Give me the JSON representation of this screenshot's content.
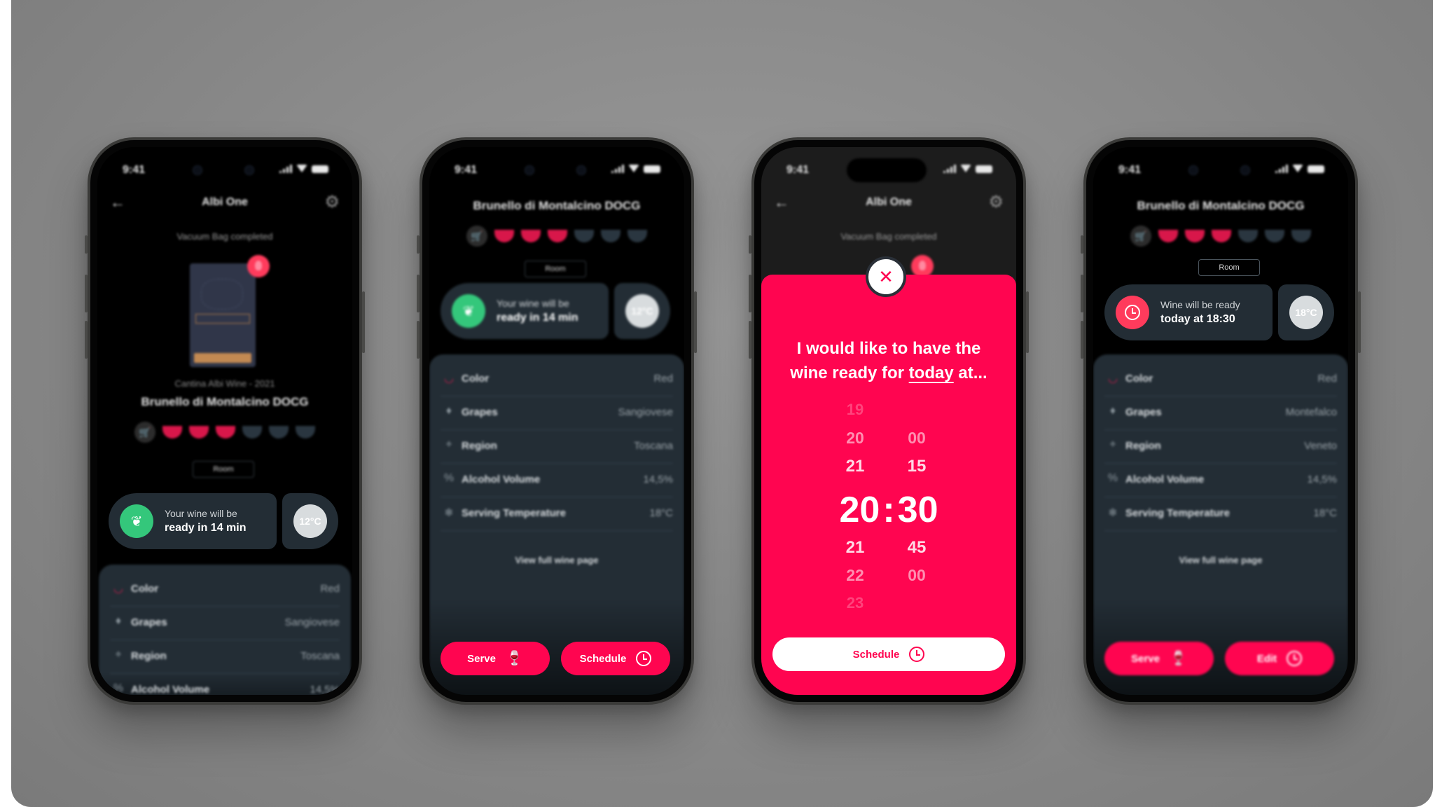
{
  "status_bar": {
    "time": "9:41"
  },
  "app": {
    "title": "Albi One",
    "subtitle": "Vacuum Bag completed"
  },
  "wine": {
    "winery": "Cantina Albi Wine - 2021",
    "name": "Brunello di Montalcino DOCG",
    "intensity_filled": 3,
    "intensity_total": 6,
    "room_label": "Room"
  },
  "icons": {
    "back": "←",
    "gear": "⚙",
    "cart": "🛒",
    "leaf": "❦",
    "close": "✕",
    "grape": "♦",
    "pin": "⌖",
    "percent": "%",
    "snow": "❄",
    "glass": "🍷"
  },
  "colors": {
    "accent": "#ff0550",
    "ready_green": "#34c77b",
    "scheduled_red": "#ff3b5c",
    "card": "#232d35"
  },
  "phones": [
    {
      "status_line1": "Your wine will be",
      "status_line2": "ready in 14 min",
      "temp": "12°C",
      "details": [
        {
          "label": "Color",
          "value": "Red"
        },
        {
          "label": "Grapes",
          "value": "Sangiovese"
        },
        {
          "label": "Region",
          "value": "Toscana"
        },
        {
          "label": "Alcohol Volume",
          "value": "14,5%"
        }
      ]
    },
    {
      "status_line1": "Your wine will be",
      "status_line2": "ready in 14 min",
      "temp": "12°C",
      "details": [
        {
          "label": "Color",
          "value": "Red"
        },
        {
          "label": "Grapes",
          "value": "Sangiovese"
        },
        {
          "label": "Region",
          "value": "Toscana"
        },
        {
          "label": "Alcohol Volume",
          "value": "14,5%"
        },
        {
          "label": "Serving Temperature",
          "value": "18°C"
        }
      ],
      "view_full": "View full wine page",
      "btn_serve": "Serve",
      "btn_schedule": "Schedule"
    },
    {
      "prompt_part1": "I would like to have the",
      "prompt_part2": "wine ready for",
      "prompt_day": "today",
      "prompt_part3": "at...",
      "hours": [
        "19",
        "20",
        "21",
        "21",
        "22",
        "23"
      ],
      "minutes": [
        "00",
        "15",
        "45",
        "00"
      ],
      "selected_hour": "20",
      "selected_minute": "30",
      "separator": ":",
      "btn_schedule": "Schedule"
    },
    {
      "status_line1": "Wine will be ready",
      "status_line2": "today at 18:30",
      "temp": "18°C",
      "details": [
        {
          "label": "Color",
          "value": "Red"
        },
        {
          "label": "Grapes",
          "value": "Montefalco"
        },
        {
          "label": "Region",
          "value": "Veneto"
        },
        {
          "label": "Alcohol Volume",
          "value": "14,5%"
        },
        {
          "label": "Serving Temperature",
          "value": "18°C"
        }
      ],
      "view_full": "View full wine page",
      "btn_serve": "Serve",
      "btn_edit": "Edit"
    }
  ]
}
